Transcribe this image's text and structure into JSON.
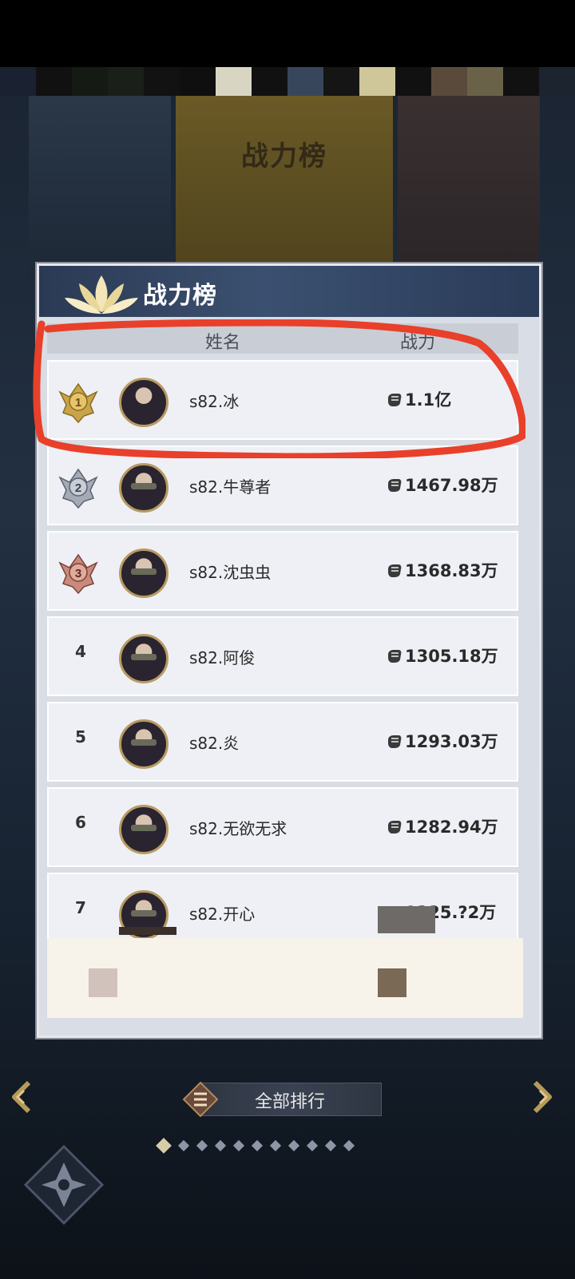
{
  "background": {
    "banner_title": "战力榜"
  },
  "panel": {
    "title": "战力榜",
    "col_name": "姓名",
    "col_power": "战力"
  },
  "rows": [
    {
      "rank": "1",
      "medal": "gold",
      "name": "s82.冰",
      "power": "1.1亿"
    },
    {
      "rank": "2",
      "medal": "silver",
      "name": "s82.牛尊者",
      "power": "1467.98万"
    },
    {
      "rank": "3",
      "medal": "bronze",
      "name": "s82.沈虫虫",
      "power": "1368.83万"
    },
    {
      "rank": "4",
      "medal": "",
      "name": "s82.阿俊",
      "power": "1305.18万"
    },
    {
      "rank": "5",
      "medal": "",
      "name": "s82.炎",
      "power": "1293.03万"
    },
    {
      "rank": "6",
      "medal": "",
      "name": "s82.无欲无求",
      "power": "1282.94万"
    },
    {
      "rank": "7",
      "medal": "",
      "name": "s82.开心",
      "power": "1225.?2万"
    }
  ],
  "bottom": {
    "all_rank_label": "全部排行",
    "page_count": 11,
    "active_page": 1
  },
  "colors": {
    "highlight_stroke": "#e8402a",
    "gold": "#c9a449",
    "silver": "#a4abb6",
    "bronze": "#c98a7c"
  }
}
